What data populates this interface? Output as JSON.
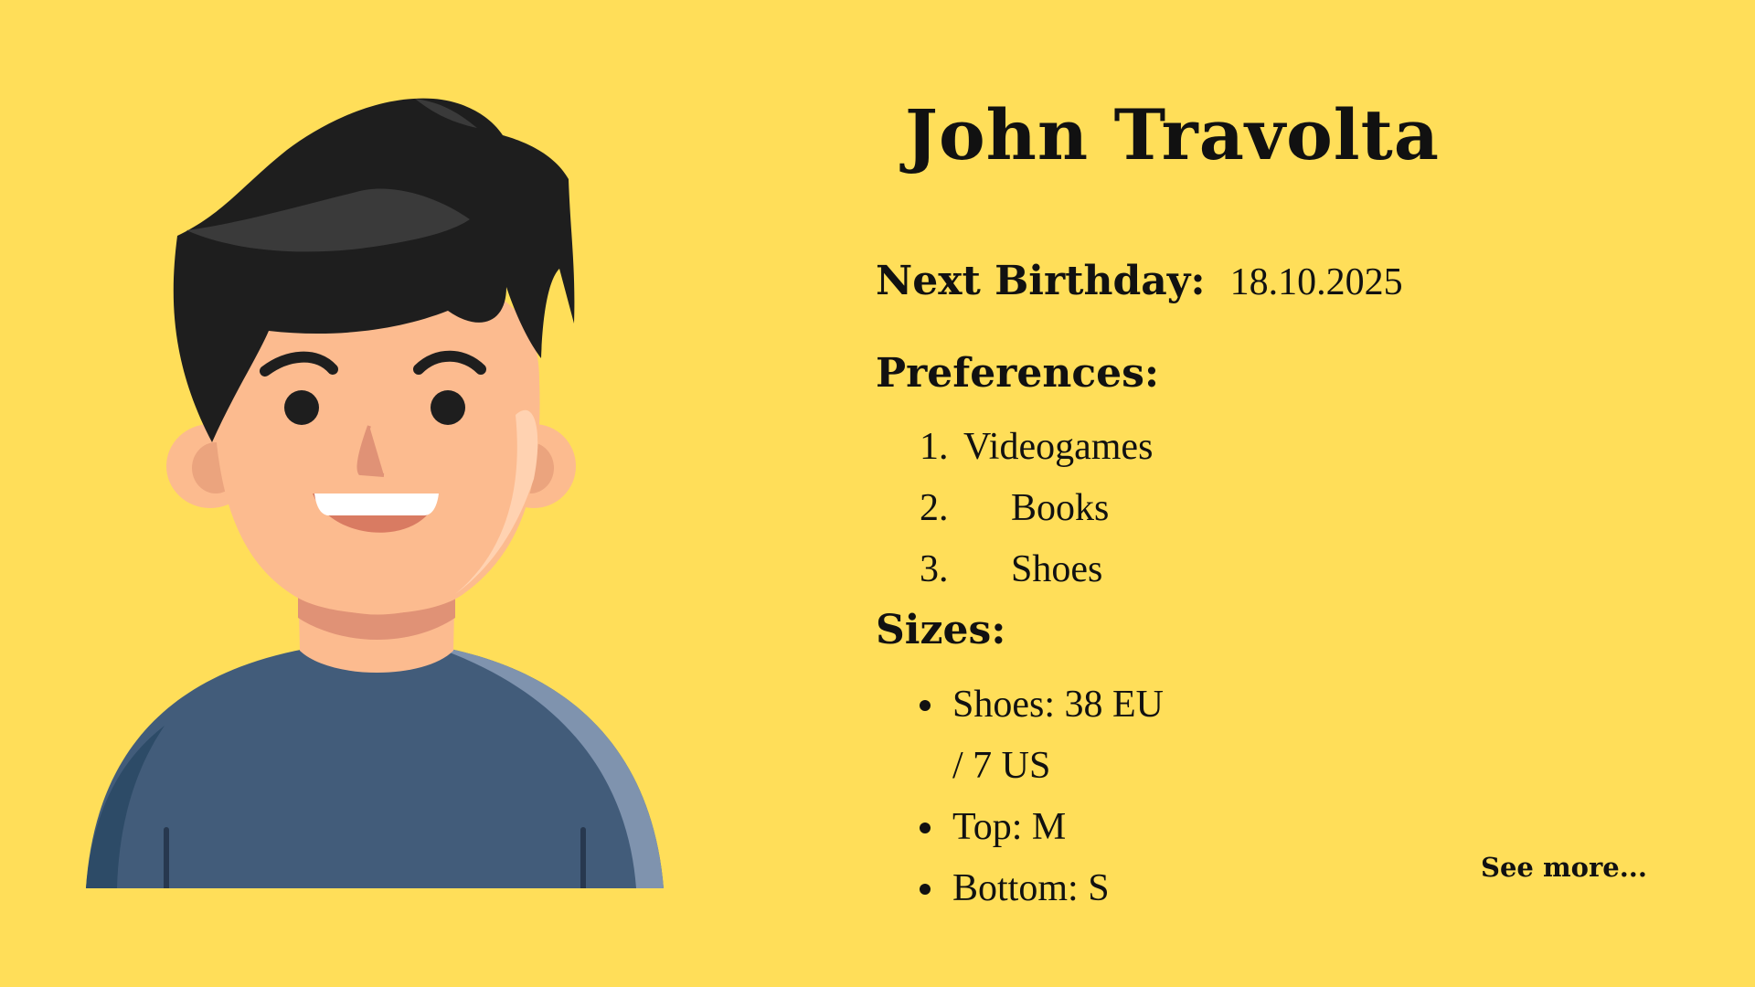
{
  "profile": {
    "name": "John Travolta",
    "birthday_label": "Next Birthday:",
    "birthday_value": "18.10.2025",
    "preferences_label": "Preferences:",
    "preferences": [
      {
        "number": "1.",
        "text": "Videogames"
      },
      {
        "number": "2.",
        "text": "Books"
      },
      {
        "number": "3.",
        "text": "Shoes"
      }
    ],
    "sizes_label": "Sizes:",
    "sizes": [
      "Shoes: 38 EU / 7 US",
      "Top: M",
      "Bottom: S"
    ],
    "see_more_label": "See more..."
  },
  "colors": {
    "background": "#FFDE59",
    "text": "#111111",
    "hair": "#1E1E1E",
    "skin": "#FCBB8F",
    "shirt": "#425C7A"
  },
  "avatar": {
    "icon": "smiling-man-avatar-illustration"
  }
}
